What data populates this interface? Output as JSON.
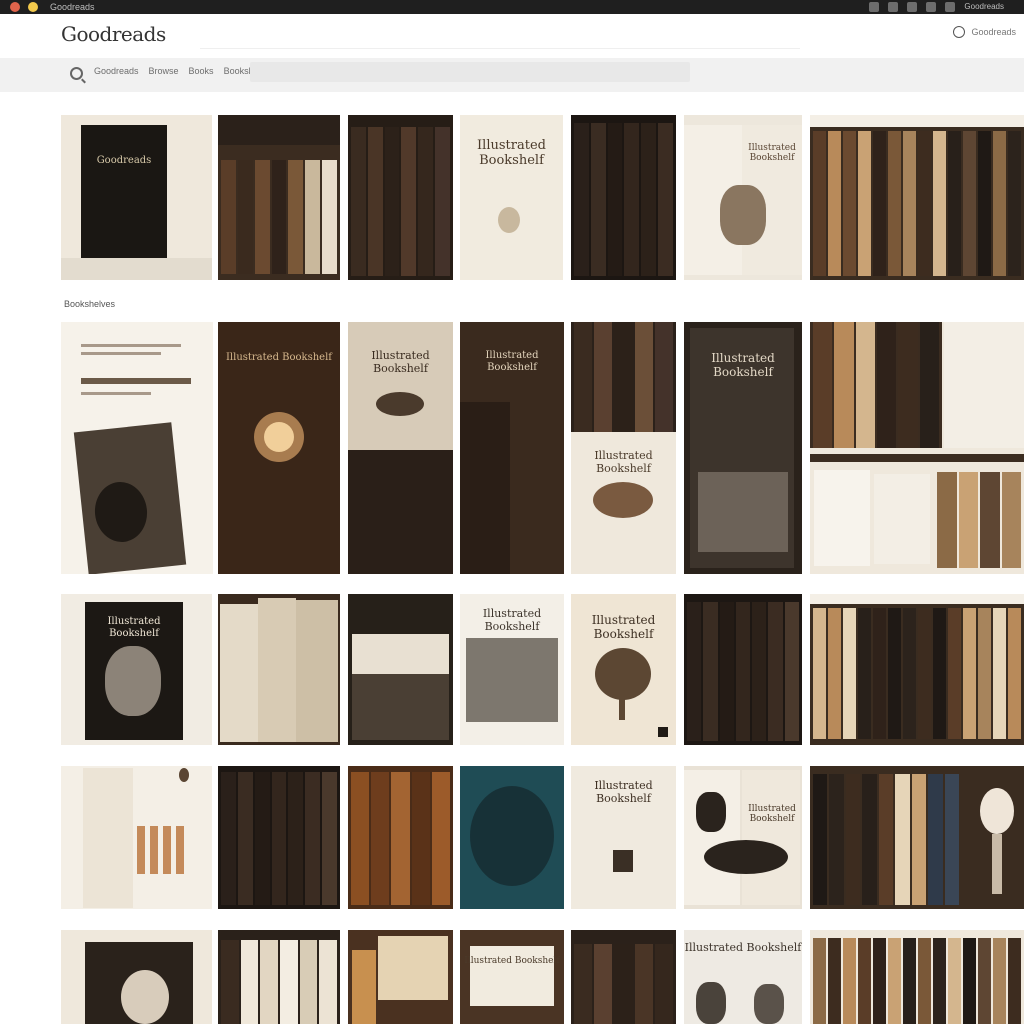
{
  "os": {
    "title": "Goodreads",
    "tray_text": "Goodreads"
  },
  "header": {
    "logo": "Goodreads",
    "user_label": "Goodreads"
  },
  "filter": {
    "crumbs": [
      "Goodreads",
      "Browse",
      "Books",
      "Bookshelves"
    ]
  },
  "section": {
    "label": "Bookshelves"
  },
  "tiles": {
    "t1": {
      "title": "Goodreads"
    },
    "t4": {
      "title": "Illustrated Bookshelf"
    },
    "t6": {
      "title": "Illustrated Bookshelf"
    },
    "t9": {
      "title": "Illustrated Bookshelf"
    },
    "t10": {
      "title": "Illustrated Bookshelf"
    },
    "t11": {
      "title": "Illustrated Bookshelf"
    },
    "t12": {
      "title": "Illustrated Bookshelf"
    },
    "t14": {
      "title": "Illustrated Bookshelf"
    },
    "t16": {
      "title": "Illustrated Bookshelf"
    },
    "t19": {
      "title": "Illustrated Bookshelf"
    },
    "t20": {
      "title": "Illustrated Bookshelf"
    },
    "t26": {
      "title": "Illustrated Bookshelf"
    },
    "t27": {
      "title": "Illustrated Bookshelf"
    },
    "t33": {
      "title": "Illustrated Bookshelf"
    },
    "t34": {
      "title": "Illustrated Bookshelf"
    }
  }
}
